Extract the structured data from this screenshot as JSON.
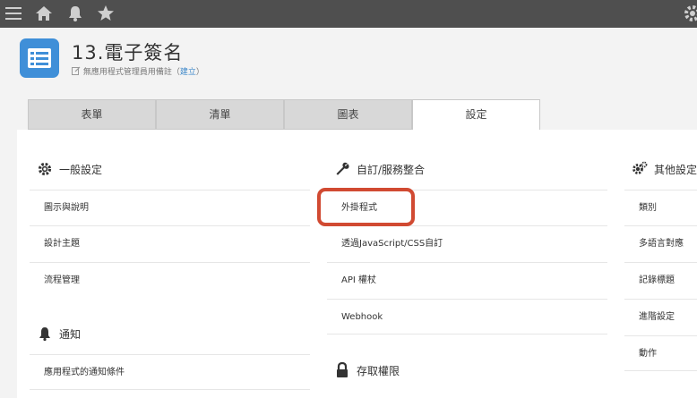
{
  "topbar": {
    "icons": [
      "menu-icon",
      "home-icon",
      "bell-icon",
      "star-icon",
      "gear-icon"
    ]
  },
  "app": {
    "title": "13.電子簽名",
    "subtitle_text": "無應用程式管理員用備註",
    "subtitle_link": "建立",
    "subtitle_open": "（",
    "subtitle_close": "）"
  },
  "tabs": [
    {
      "label": "表單"
    },
    {
      "label": "清單"
    },
    {
      "label": "圖表"
    },
    {
      "label": "設定"
    }
  ],
  "general": {
    "title": "一般設定",
    "items": [
      "圖示與說明",
      "設計主題",
      "流程管理"
    ]
  },
  "notify": {
    "title": "通知",
    "items": [
      "應用程式的通知條件"
    ]
  },
  "custom": {
    "title": "自訂/服務整合",
    "items": [
      "外掛程式",
      "透過JavaScript/CSS自訂",
      "API 權杖",
      "Webhook"
    ]
  },
  "access": {
    "title": "存取權限"
  },
  "other": {
    "title": "其他設定",
    "items": [
      "類別",
      "多語言對應",
      "記錄標題",
      "進階設定",
      "動作"
    ]
  },
  "colors": {
    "topbar": "#4f4f4f",
    "app_icon": "#3f8fd8",
    "highlight": "#d14a32",
    "link": "#3a86c8"
  }
}
